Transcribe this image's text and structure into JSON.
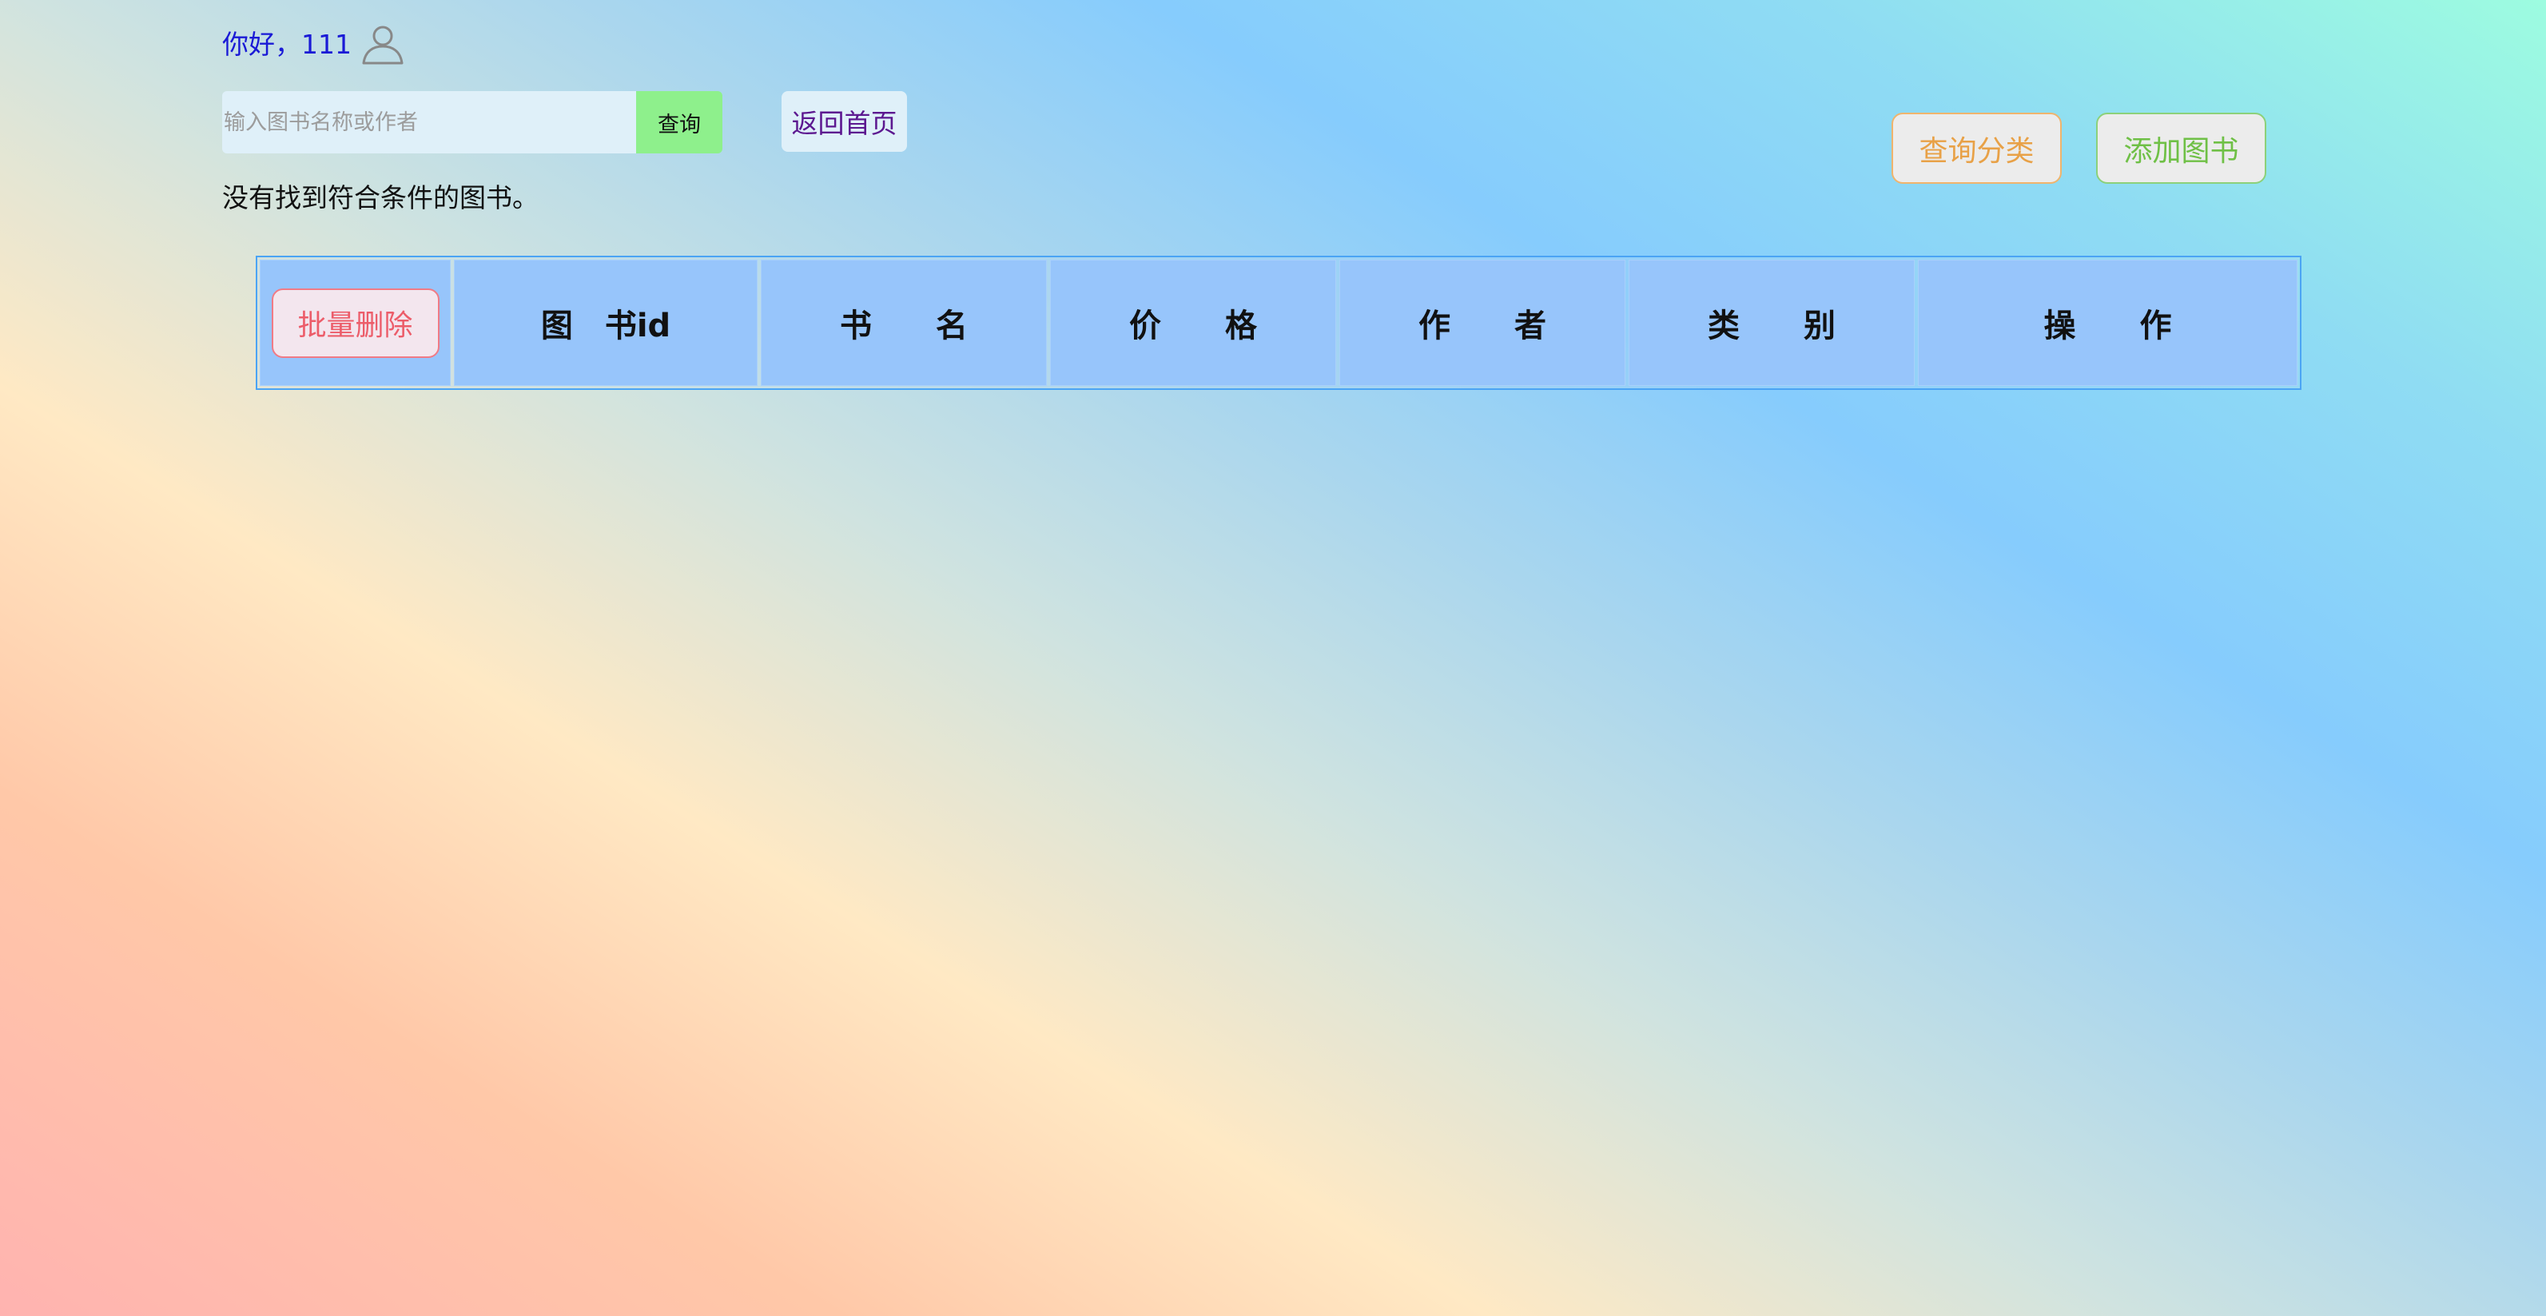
{
  "header": {
    "greeting": "你好，111",
    "user_icon": "user-icon"
  },
  "search": {
    "placeholder": "输入图书名称或作者",
    "value": "",
    "button_label": "查询"
  },
  "nav": {
    "home_label": "返回首页"
  },
  "actions": {
    "query_category_label": "查询分类",
    "add_book_label": "添加图书"
  },
  "message": {
    "no_result": "没有找到符合条件的图书。"
  },
  "table": {
    "batch_delete_label": "批量删除",
    "columns": [
      "图　书id",
      "书　　名",
      "价　　格",
      "作　　者",
      "类　　别",
      "操　　作"
    ],
    "rows": []
  },
  "colors": {
    "greeting": "#1a1ad6",
    "search_button": "#8ef08c",
    "home_text": "#5c1890",
    "query_category": "#e8a147",
    "add_book": "#6fc046",
    "batch_delete": "#ec5d6a",
    "table_header": "#97c5fb",
    "table_border": "#4ba4f4"
  }
}
